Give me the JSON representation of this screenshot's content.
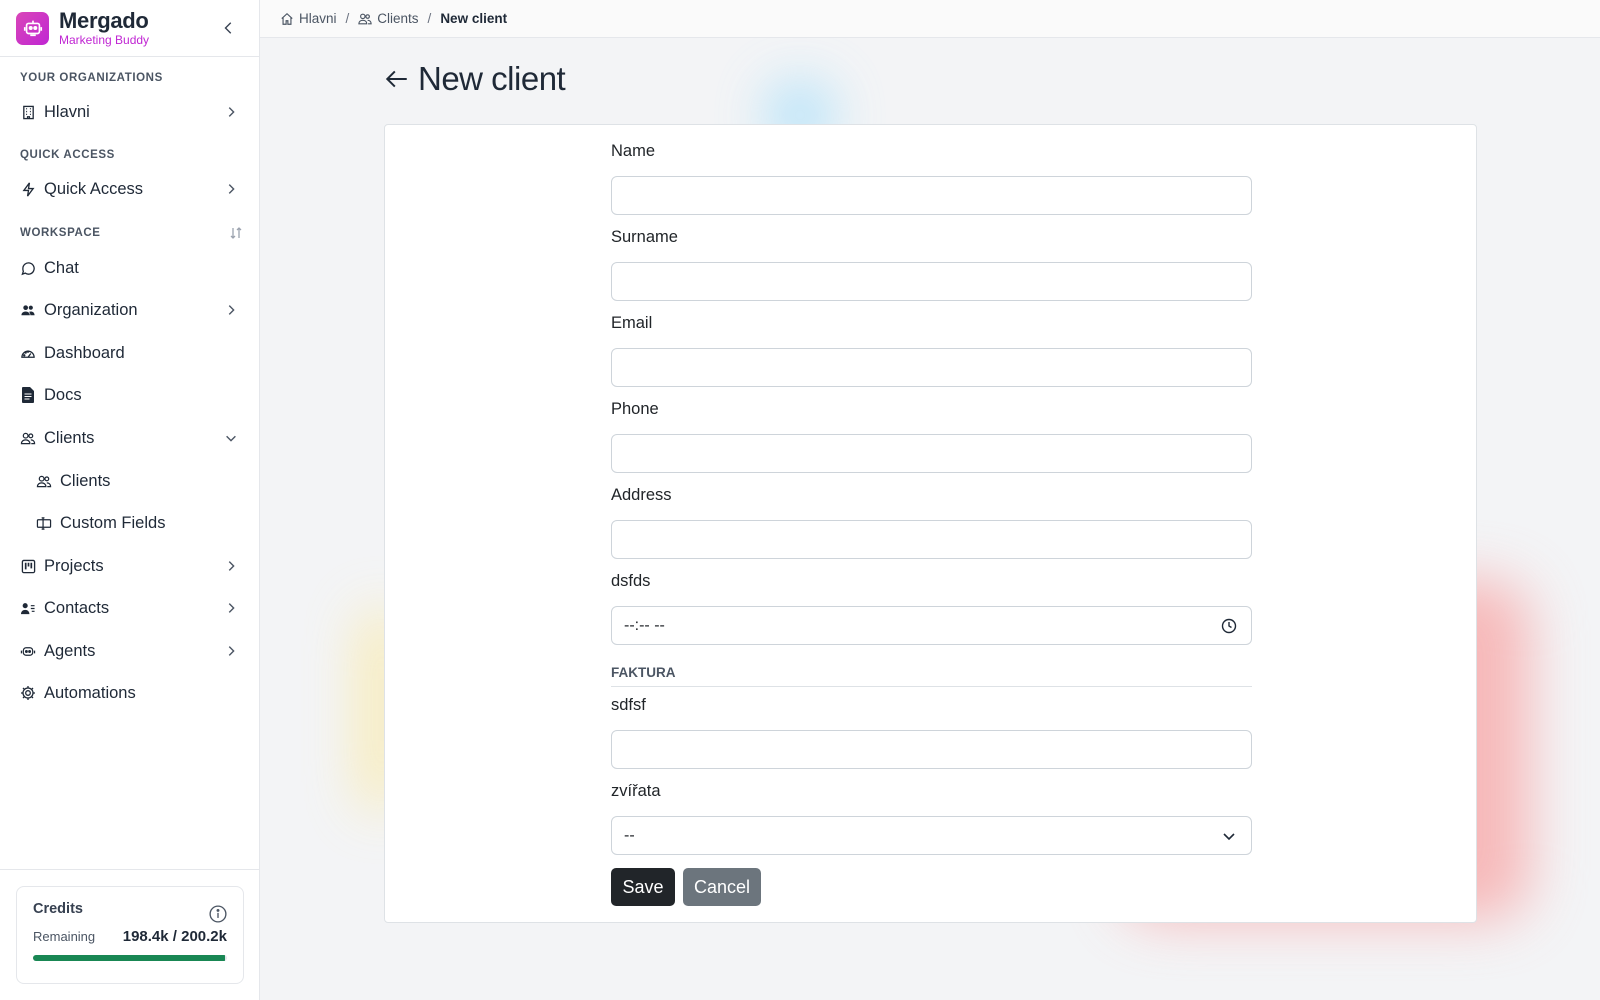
{
  "brand": {
    "name": "Mergado",
    "subtitle": "Marketing Buddy"
  },
  "sidebar": {
    "orgs_title": "YOUR ORGANIZATIONS",
    "org_item": "Hlavni",
    "quick_title": "QUICK ACCESS",
    "quick_item": "Quick Access",
    "workspace_title": "WORKSPACE",
    "items": [
      {
        "label": "Chat",
        "icon": "chat-icon"
      },
      {
        "label": "Organization",
        "icon": "users-icon"
      },
      {
        "label": "Dashboard",
        "icon": "dashboard-icon"
      },
      {
        "label": "Docs",
        "icon": "document-icon"
      },
      {
        "label": "Clients",
        "icon": "clients-icon"
      },
      {
        "label": "Clients",
        "icon": "clients-icon"
      },
      {
        "label": "Custom Fields",
        "icon": "custom-fields-icon"
      },
      {
        "label": "Projects",
        "icon": "projects-icon"
      },
      {
        "label": "Contacts",
        "icon": "contacts-icon"
      },
      {
        "label": "Agents",
        "icon": "agents-icon"
      },
      {
        "label": "Automations",
        "icon": "gear-icon"
      }
    ]
  },
  "credits": {
    "title": "Credits",
    "remaining_label": "Remaining",
    "value": "198.4k / 200.2k",
    "progress": 0.991
  },
  "breadcrumb": {
    "home": "Hlavni",
    "clients": "Clients",
    "current": "New client"
  },
  "page": {
    "title": "New client"
  },
  "form": {
    "name_label": "Name",
    "surname_label": "Surname",
    "email_label": "Email",
    "phone_label": "Phone",
    "address_label": "Address",
    "dsfds_label": "dsfds",
    "time_value": "--:-- --",
    "section_title": "FAKTURA",
    "sdfsf_label": "sdfsf",
    "zvirata_label": "zvířata",
    "select_value": "--",
    "save_label": "Save",
    "cancel_label": "Cancel"
  },
  "colors": {
    "accent": "#c026d3",
    "progress": "#198754",
    "save_button": "#212529",
    "cancel_button": "#6c757d"
  }
}
